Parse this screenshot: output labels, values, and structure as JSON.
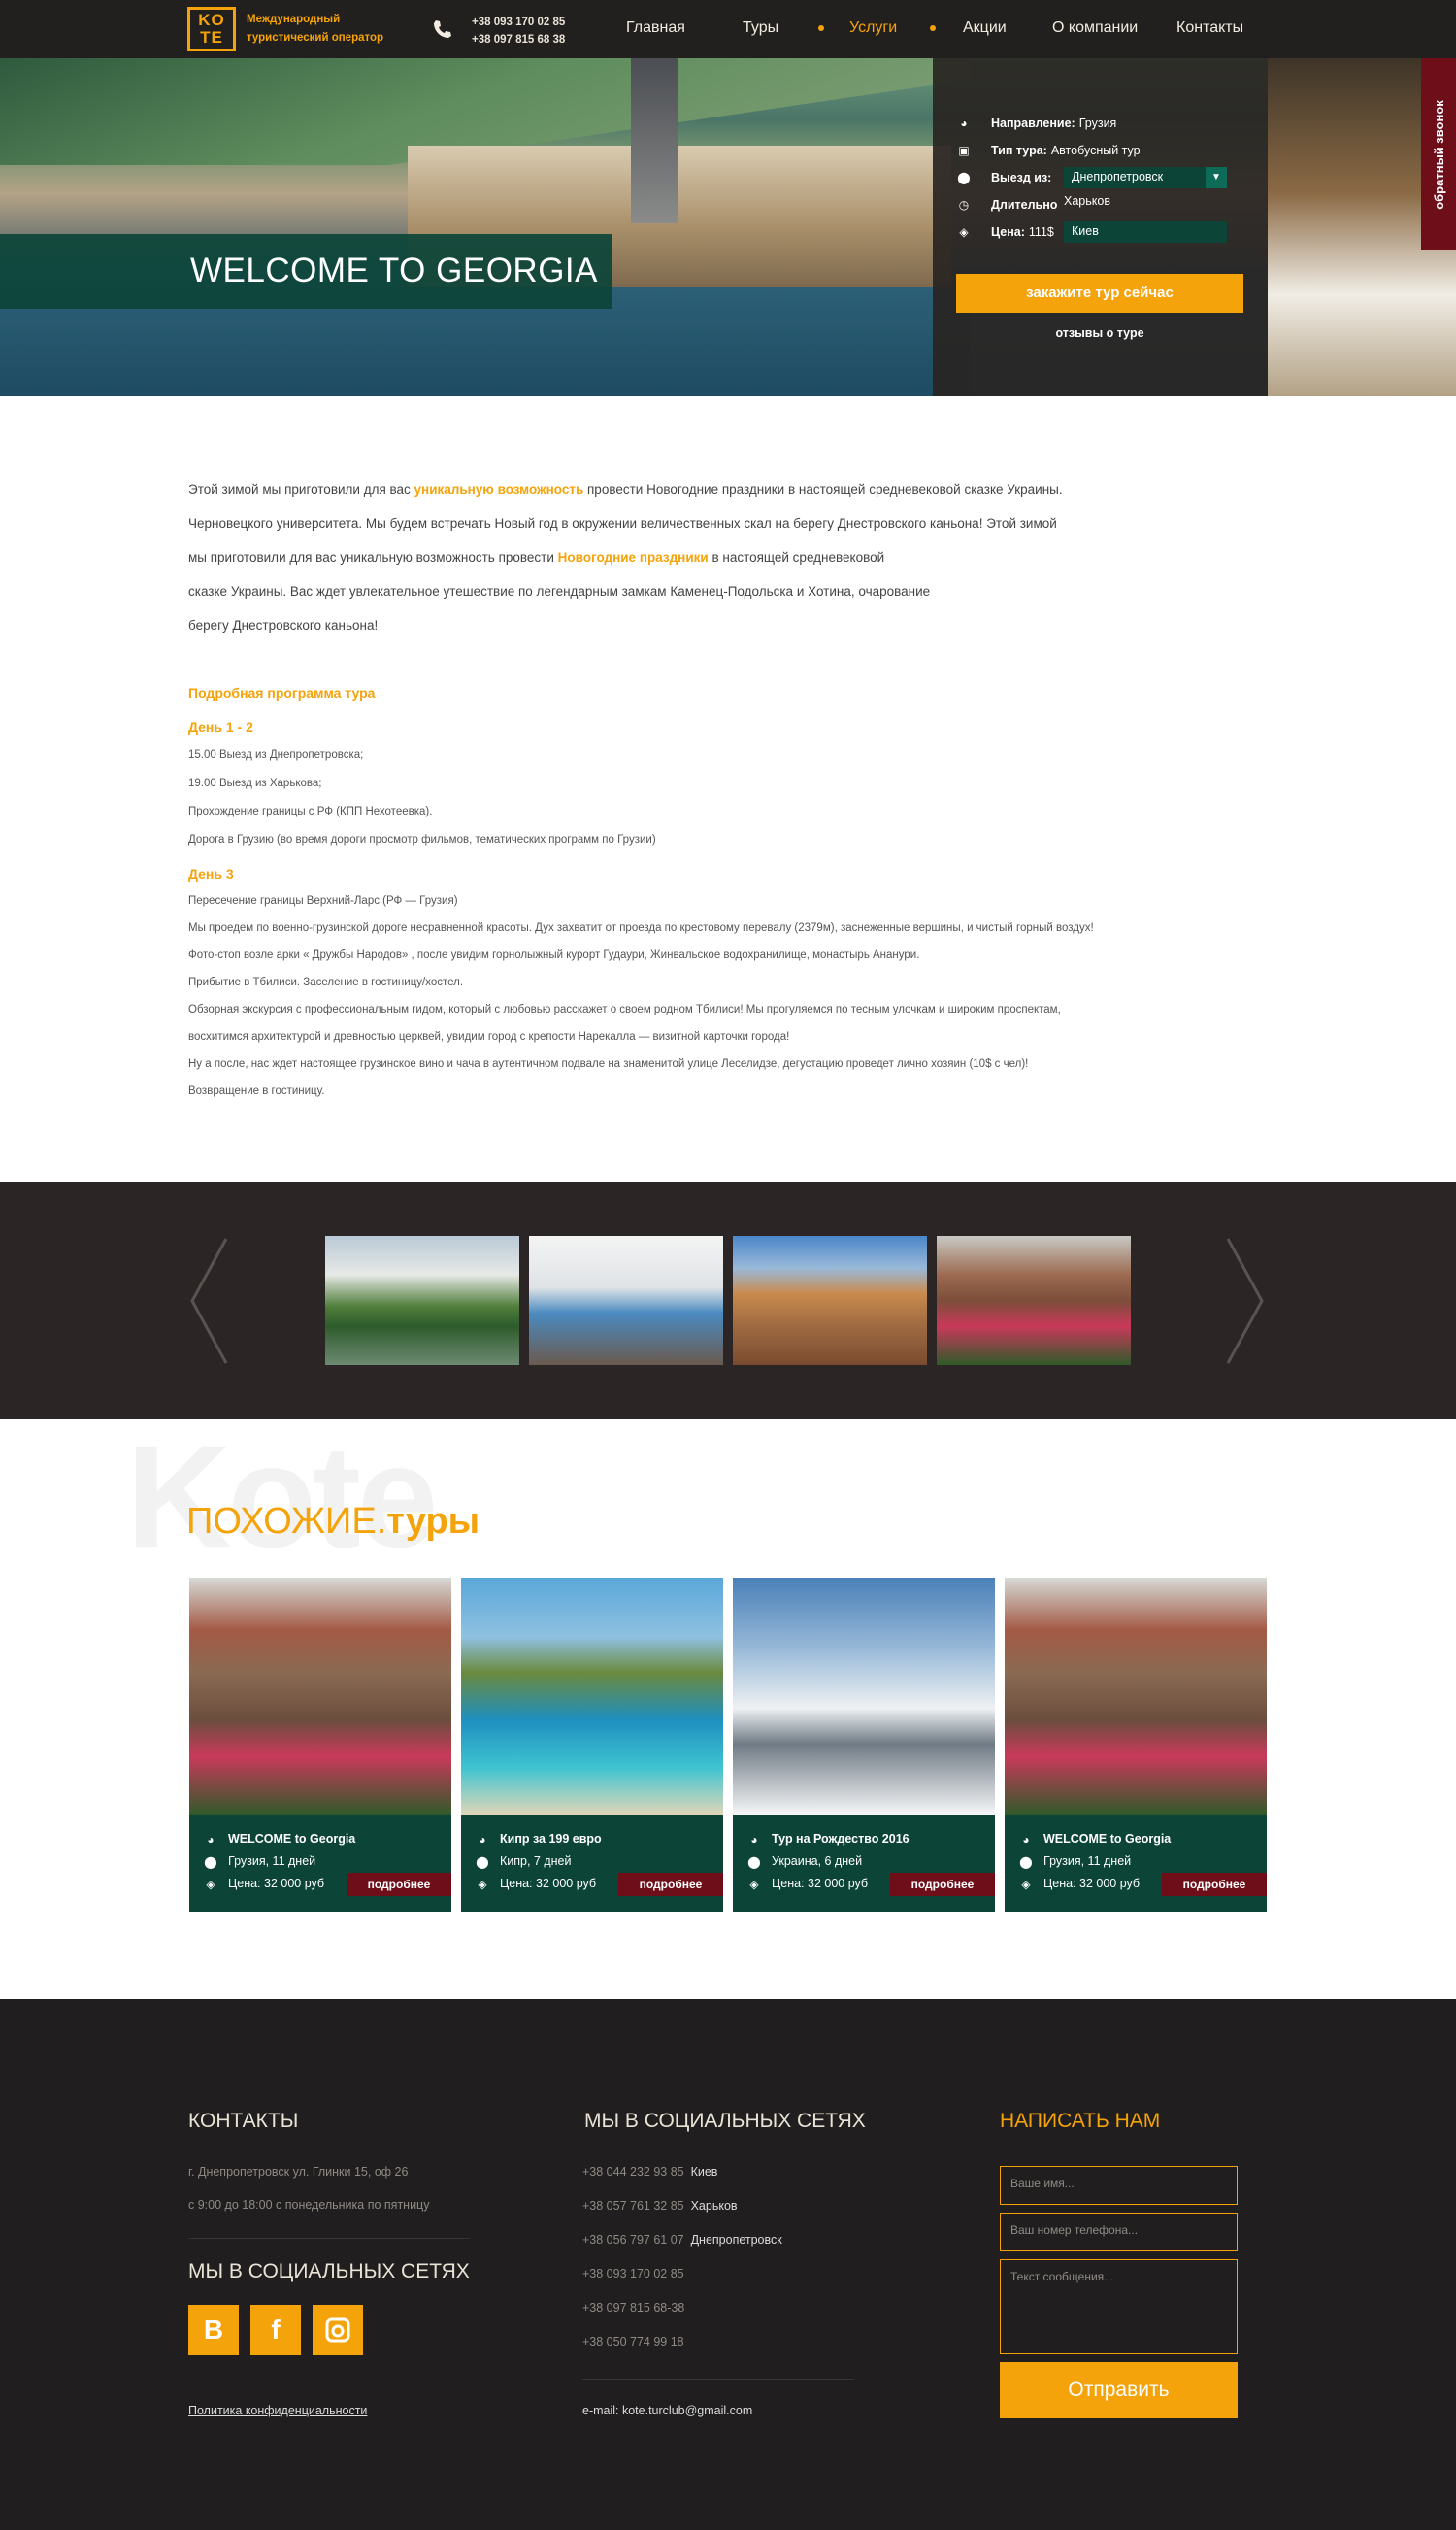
{
  "header": {
    "logo_top": "KO",
    "logo_bottom": "TE",
    "tagline_line1": "Международный",
    "tagline_line2": "туристический оператор",
    "phone1": "+38 093 170 02 85",
    "phone2": "+38 097 815 68 38",
    "nav": [
      "Главная",
      "Туры",
      "Услуги",
      "Акции",
      "О компании",
      "Контакты"
    ],
    "active_nav": "Услуги"
  },
  "hero": {
    "title": "WELCOME TO GEORGIA",
    "panel": {
      "direction_label": "Направление:",
      "direction_value": "Грузия",
      "type_label": "Тип тура:",
      "type_value": "Автобусный тур",
      "departure_label": "Выезд из:",
      "departure_selected": "Днепропетровск",
      "departure_option2": "Харьков",
      "departure_option3": "Киев",
      "duration_label": "Длительно",
      "price_label": "Цена:",
      "price_value": "111$",
      "order_button": "закажите тур сейчас",
      "reviews_link": "отзывы о туре"
    },
    "callback": "обратный звонок"
  },
  "intro": {
    "l1_a": "Этой зимой мы приготовили для вас ",
    "l1_hl": "уникальную возможность",
    "l1_b": " провести Новогодние праздники в настоящей средневековой сказке Украины.",
    "l2": "Черновецкого университета. Мы будем встречать Новый год в окружении величественных скал на берегу Днестровского каньона! Этой зимой",
    "l3_a": "мы приготовили для вас уникальную возможность провести ",
    "l3_hl": "Новогодние праздники",
    "l3_b": " в настоящей средневековой",
    "l4": "сказке Украины. Вас ждет увлекательное утешествие по легендарным замкам Каменец-Подольска и Хотина, очарование",
    "l5": "берегу Днестровского каньона!"
  },
  "program": {
    "title": "Подробная программа тура",
    "day1_title": "День 1 - 2",
    "day1": [
      "15.00 Выезд из Днепропетровска;",
      "19.00 Выезд из Харькова;",
      "Прохождение границы с РФ (КПП Нехотеевка).",
      "Дорога в Грузию (во время дороги просмотр фильмов, тематических программ по Грузии)"
    ],
    "day3_title": "День 3",
    "day3": [
      "Пересечение границы Верхний-Ларс (РФ — Грузия)",
      "Мы проедем по военно-грузинской дороге несравненной красоты. Дух захватит от проезда по крестовому перевалу (2379м), заснеженные вершины, и чистый горный воздух!",
      "Фото-стоп возле арки « Дружбы Народов» , после увидим  горнолыжный курорт Гудаури,  Жинвальское водохранилище, монастырь Ананури.",
      "Прибытие в Тбилиси. Заселение в гостиницу/хостел.",
      "Обзорная экскурсия с профессиональным гидом, который с любовью расскажет о своем родном Тбилиси! Мы прогуляемся по тесным улочкам и широким проспектам,",
      "восхитимся архитектурой и древностью церквей, увидим город с крепости Нарекалла — визитной карточки города!",
      "Ну а после, нас ждет настоящее грузинское вино и чача в аутентичном подвале на знаменитой улице Леселидзе, дегустацию проведет лично хозяин (10$ с чел)!",
      "Возвращение в гостиницу."
    ]
  },
  "gallery": {
    "prev_icon": "chevron-left-icon",
    "next_icon": "chevron-right-icon"
  },
  "similar": {
    "watermark": "Kote",
    "title_a": "ПОХОЖИЕ.",
    "title_b": "туры",
    "cards": [
      {
        "name": "WELCOME to Georgia",
        "location": "Грузия, 11 дней",
        "price": "Цена: 32 000 руб",
        "more": "подробнее"
      },
      {
        "name": "Кипр за 199 евро",
        "location": "Кипр, 7 дней",
        "price": "Цена: 32 000 руб",
        "more": "подробнее"
      },
      {
        "name": "Тур на Рождество 2016",
        "location": "Украина, 6 дней",
        "price": "Цена: 32 000 руб",
        "more": "подробнее"
      },
      {
        "name": "WELCOME to Georgia",
        "location": "Грузия, 11 дней",
        "price": "Цена: 32 000 руб",
        "more": "подробнее"
      }
    ]
  },
  "footer": {
    "contacts_title": "КОНТАКТЫ",
    "address": "г. Днепропетровск ул. Глинки 15, оф 26",
    "hours": "с 9:00 до 18:00 с понедельника по пятницу",
    "social_title_left": "МЫ В СОЦИАЛЬНЫХ СЕТЯХ",
    "social_vk": "В",
    "social_fb": "f",
    "privacy": "Политика конфиденциальности",
    "social_title_mid": "МЫ В СОЦИАЛЬНЫХ СЕТЯХ",
    "phones": [
      {
        "num": "+38 044 232 93 85",
        "city": "Киев"
      },
      {
        "num": "+38 057 761 32 85",
        "city": "Харьков"
      },
      {
        "num": "+38 056 797 61 07",
        "city": "Днепропетровск"
      },
      {
        "num": "+38 093 170 02 85",
        "city": ""
      },
      {
        "num": "+38 097 815 68-38",
        "city": ""
      },
      {
        "num": "+38 050 774 99 18",
        "city": ""
      }
    ],
    "email": "e-mail: kote.turclub@gmail.com",
    "write_title": "НАПИСАТЬ НАМ",
    "name_placeholder": "Ваше имя...",
    "phone_placeholder": "Ваш номер телефона...",
    "message_placeholder": "Текст сообщения...",
    "send_button": "Отправить"
  },
  "colors": {
    "accent": "#f5a30a",
    "dark": "#221f1f",
    "green": "#0c4438",
    "maroon": "#6d0e19"
  }
}
